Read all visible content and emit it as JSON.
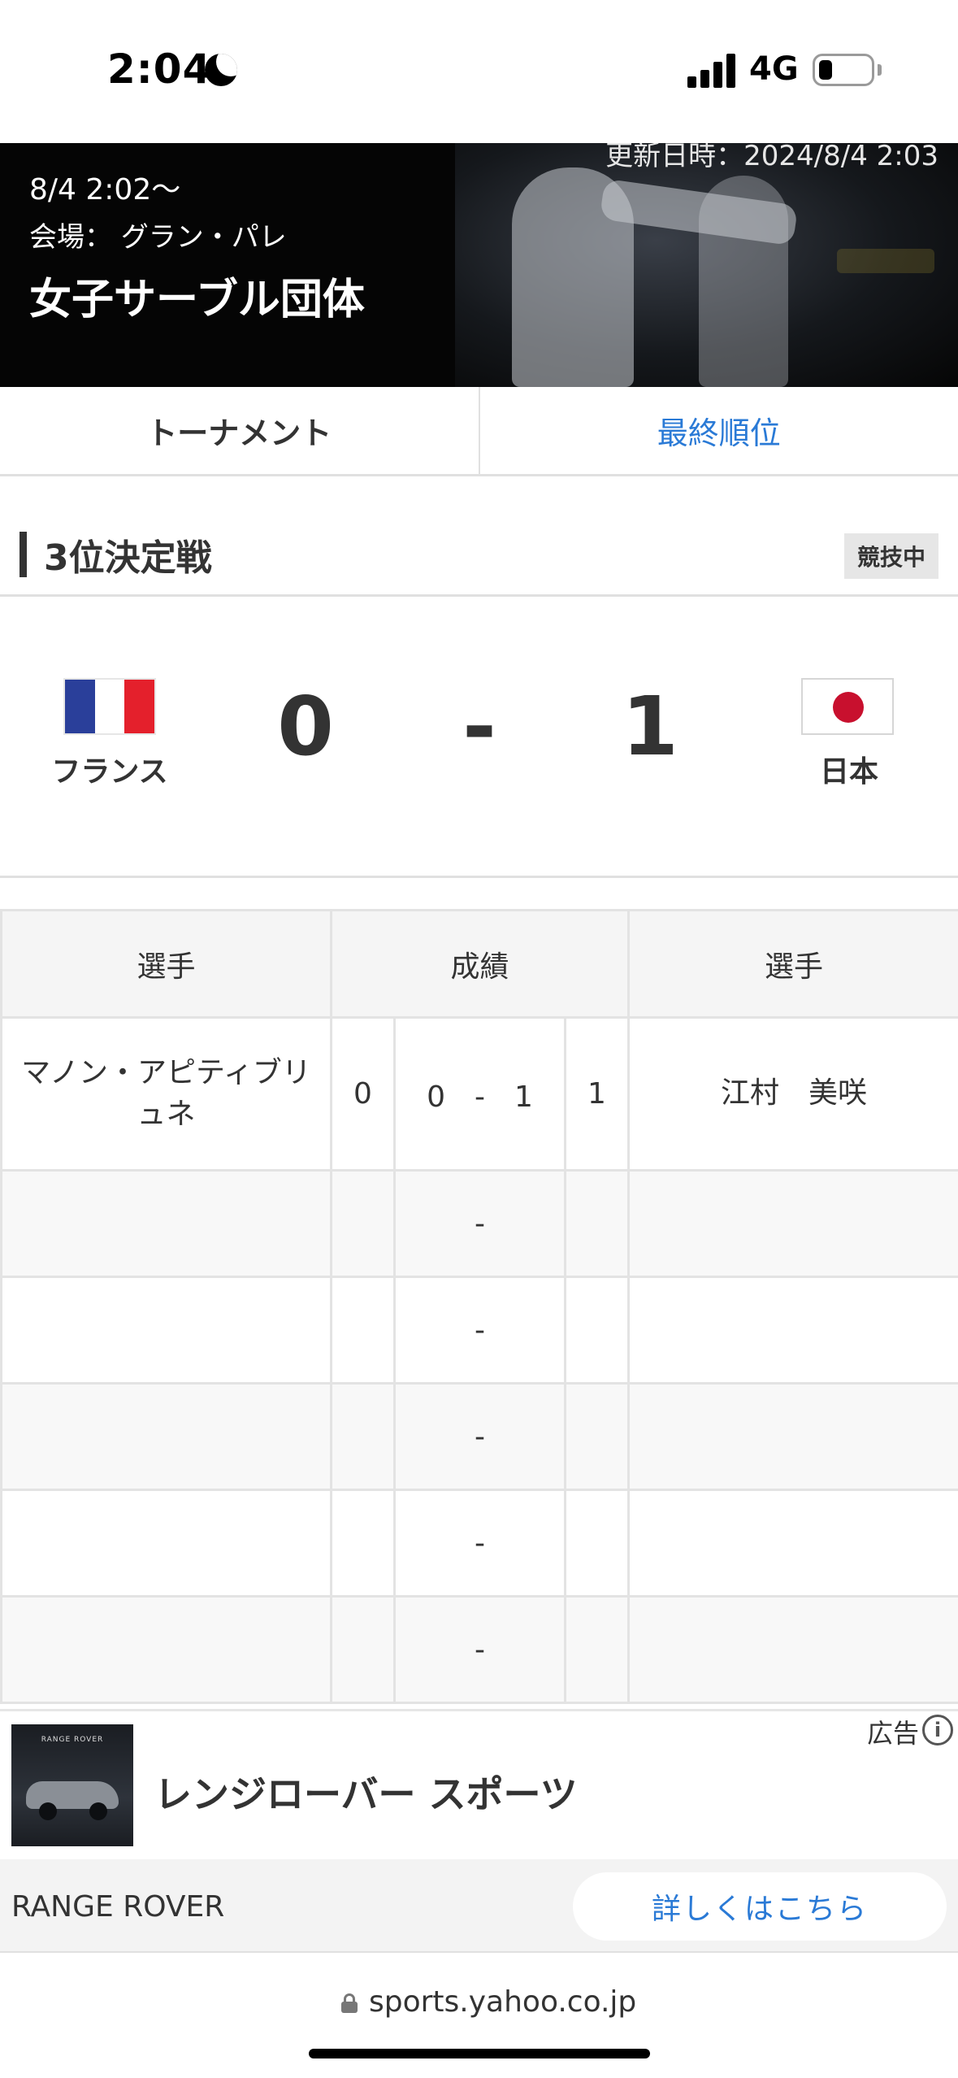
{
  "status_bar": {
    "time": "2:04",
    "network": "4G"
  },
  "hero": {
    "updated": "更新日時：2024/8/4 2:03",
    "date": "8/4 2:02〜",
    "venue": "会場： グラン・パレ",
    "title": "女子サーブル団体"
  },
  "tabs": [
    {
      "label": "トーナメント",
      "active": true
    },
    {
      "label": "最終順位",
      "active": false
    }
  ],
  "section": {
    "title": "3位決定戦",
    "status": "競技中"
  },
  "match": {
    "left_team": "フランス",
    "left_score": "0",
    "separator": "-",
    "right_score": "1",
    "right_team": "日本",
    "flag_colors": {
      "france": [
        "#2a3f9a",
        "#ffffff",
        "#e4202c"
      ],
      "japan_disc": "#c8102e"
    }
  },
  "table": {
    "headers": [
      "選手",
      "成績",
      "選手"
    ],
    "rows": [
      {
        "left_player": "マノン・アピティブリュネ",
        "left_total": "0",
        "bout": "0　-　1",
        "right_total": "1",
        "right_player": "江村　美咲"
      },
      {
        "left_player": "",
        "left_total": "",
        "bout": "-",
        "right_total": "",
        "right_player": ""
      },
      {
        "left_player": "",
        "left_total": "",
        "bout": "-",
        "right_total": "",
        "right_player": ""
      },
      {
        "left_player": "",
        "left_total": "",
        "bout": "-",
        "right_total": "",
        "right_player": ""
      },
      {
        "left_player": "",
        "left_total": "",
        "bout": "-",
        "right_total": "",
        "right_player": ""
      },
      {
        "left_player": "",
        "left_total": "",
        "bout": "-",
        "right_total": "",
        "right_player": ""
      }
    ]
  },
  "ad": {
    "label": "広告",
    "info_icon": "i",
    "thumb_brand": "RANGE ROVER",
    "title": "レンジローバー スポーツ",
    "advertiser": "RANGE ROVER",
    "cta": "詳しくはこちら"
  },
  "url_bar": {
    "url": "sports.yahoo.co.jp"
  },
  "colors": {
    "link_blue": "#2a7ad6",
    "text": "#333333",
    "border": "#e3e3e3",
    "header_bg": "#f5f5f5"
  }
}
